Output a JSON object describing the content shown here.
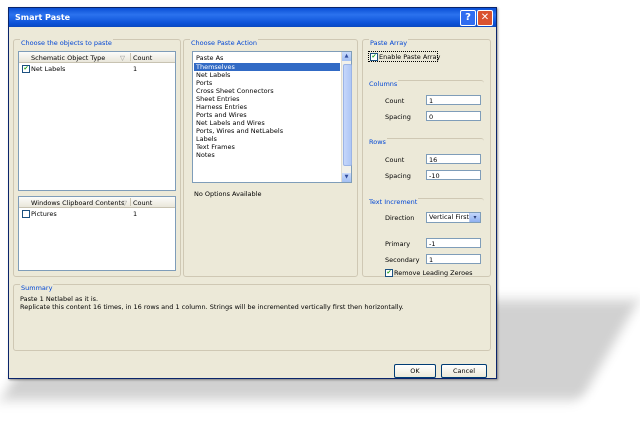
{
  "window": {
    "title": "Smart Paste"
  },
  "objects_group": {
    "title": "Choose the objects to paste",
    "schematic_list": {
      "col_type": "Schematic Object Type",
      "col_count": "Count",
      "rows": [
        {
          "label": "Net Labels",
          "count": "1",
          "checked": true
        }
      ]
    },
    "clipboard_list": {
      "col_type": "Windows Clipboard Contents",
      "col_count": "Count",
      "rows": [
        {
          "label": "Pictures",
          "count": "1",
          "checked": false
        }
      ]
    }
  },
  "paste_action_group": {
    "title": "Choose Paste Action",
    "header": "Paste As",
    "items": [
      "Themselves",
      "Net Labels",
      "Ports",
      "Cross Sheet Connectors",
      "Sheet Entries",
      "Harness Entries",
      "Ports and Wires",
      "Net Labels and Wires",
      "Ports, Wires and NetLabels",
      "Labels",
      "Text Frames",
      "Notes"
    ],
    "selected": "Themselves",
    "no_options": "No Options Available"
  },
  "paste_array_group": {
    "title": "Paste Array",
    "enable_label": "Enable Paste Array",
    "enable_checked": true,
    "columns": {
      "title": "Columns",
      "count_label": "Count",
      "count": "1",
      "spacing_label": "Spacing",
      "spacing": "0"
    },
    "rows": {
      "title": "Rows",
      "count_label": "Count",
      "count": "16",
      "spacing_label": "Spacing",
      "spacing": "-10"
    },
    "text_increment": {
      "title": "Text Increment",
      "direction_label": "Direction",
      "direction": "Vertical First",
      "primary_label": "Primary",
      "primary": "-1",
      "secondary_label": "Secondary",
      "secondary": "1",
      "remove_zeroes_label": "Remove Leading Zeroes",
      "remove_zeroes_checked": true
    }
  },
  "summary": {
    "title": "Summary",
    "line1": "Paste 1 Netlabel as it is.",
    "line2": "Replicate this content 16 times, in 16 rows and 1 column. Strings will be incremented vertically first then horizontally."
  },
  "buttons": {
    "ok": "OK",
    "cancel": "Cancel"
  },
  "icons": {
    "check": "✔",
    "dropdown": "▾",
    "scroll_up": "▲",
    "scroll_down": "▼",
    "help": "?",
    "close": "✕",
    "sort": "▽"
  }
}
